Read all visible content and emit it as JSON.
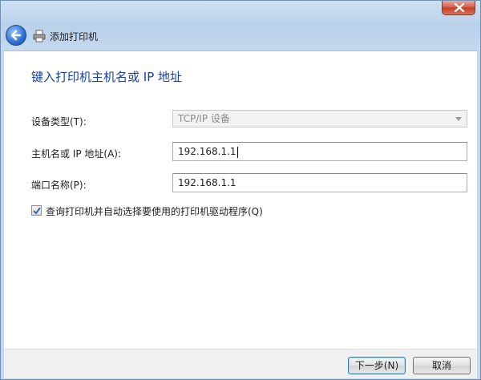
{
  "window": {
    "title": "添加打印机"
  },
  "page": {
    "heading": "键入打印机主机名或 IP 地址"
  },
  "form": {
    "device_type": {
      "label": "设备类型(T):",
      "value": "TCP/IP 设备"
    },
    "hostname": {
      "label": "主机名或 IP 地址(A):",
      "value": "192.168.1.1"
    },
    "port_name": {
      "label": "端口名称(P):",
      "value": "192.168.1.1"
    },
    "auto_driver": {
      "label": "查询打印机并自动选择要使用的打印机驱动程序(Q)",
      "checked": true
    }
  },
  "footer": {
    "next_label": "下一步(N)",
    "cancel_label": "取消"
  },
  "colors": {
    "heading": "#1a3f9f",
    "close": "#c23c22"
  }
}
